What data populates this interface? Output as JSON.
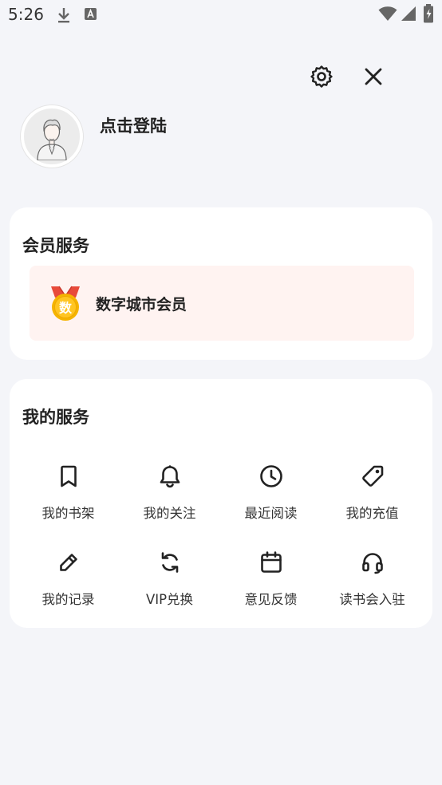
{
  "status_bar": {
    "time": "5:26",
    "icons": [
      "download-icon",
      "font-icon",
      "wifi-icon",
      "signal-icon",
      "battery-icon"
    ]
  },
  "header": {
    "actions": [
      "settings-icon",
      "close-icon"
    ],
    "login_text": "点击登陆"
  },
  "member_card": {
    "title": "会员服务",
    "item_label": "数字城市会员",
    "badge_char": "数"
  },
  "services_card": {
    "title": "我的服务",
    "items": [
      {
        "label": "我的书架",
        "icon": "bookmark-icon"
      },
      {
        "label": "我的关注",
        "icon": "bell-icon"
      },
      {
        "label": "最近阅读",
        "icon": "clock-icon"
      },
      {
        "label": "我的充值",
        "icon": "tag-icon"
      },
      {
        "label": "我的记录",
        "icon": "pencil-icon"
      },
      {
        "label": "VIP兑换",
        "icon": "refresh-icon"
      },
      {
        "label": "意见反馈",
        "icon": "calendar-icon"
      },
      {
        "label": "读书会入驻",
        "icon": "headset-icon"
      }
    ]
  },
  "colors": {
    "background": "#f4f5f9",
    "card": "#ffffff",
    "vip_row": "#fff3f1",
    "badge_gold": "#f5b400",
    "badge_ribbon": "#e84a3a"
  }
}
